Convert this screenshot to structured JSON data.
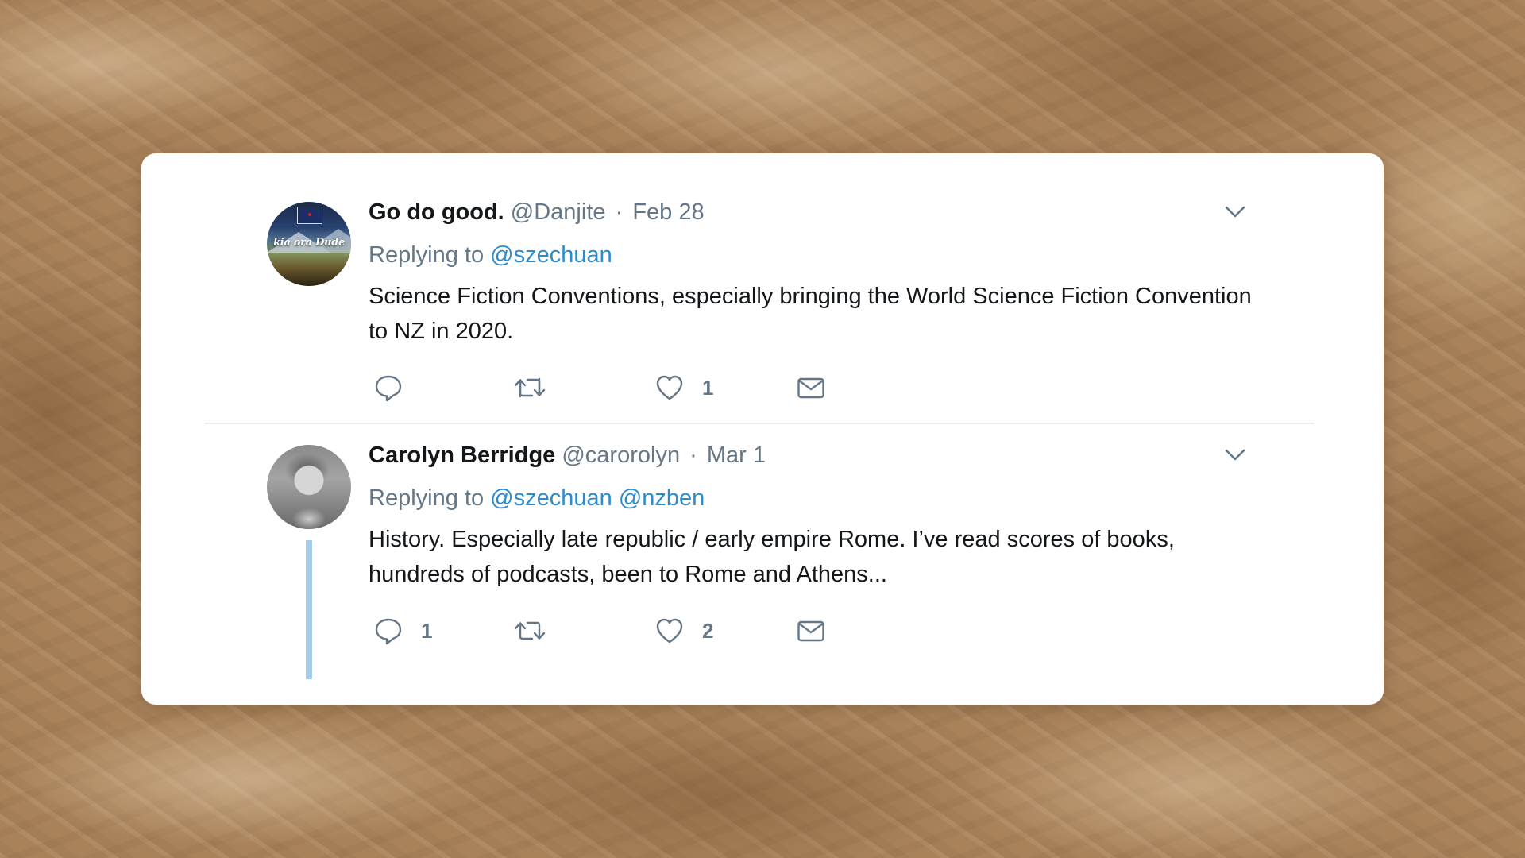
{
  "colors": {
    "card_background": "#ffffff",
    "name_text": "#14171a",
    "secondary_text": "#657786",
    "mention_link": "#2a8ccf",
    "thread_line": "#a3cde6",
    "background_marble": "#a9825a"
  },
  "tweets": [
    {
      "display_name": "Go do good.",
      "handle": "@Danjite",
      "separator": "·",
      "date": "Feb 28",
      "replying_to_label": "Replying to",
      "mentions": [
        "@szechuan"
      ],
      "text": "Science Fiction Conventions, especially bringing the World Science Fiction Convention to NZ in 2020.",
      "avatar_text": "kia ora Dude",
      "actions": {
        "reply_count": "",
        "retweet_count": "",
        "like_count": "1"
      },
      "icons": [
        "reply-icon",
        "retweet-icon",
        "like-icon",
        "direct-message-icon",
        "chevron-down-icon"
      ]
    },
    {
      "display_name": "Carolyn Berridge",
      "handle": "@carorolyn",
      "separator": "·",
      "date": "Mar 1",
      "replying_to_label": "Replying to",
      "mentions": [
        "@szechuan",
        "@nzben"
      ],
      "text": "History. Especially late republic / early empire Rome. I’ve read scores of books, hundreds of podcasts, been to Rome and Athens...",
      "actions": {
        "reply_count": "1",
        "retweet_count": "",
        "like_count": "2"
      },
      "icons": [
        "reply-icon",
        "retweet-icon",
        "like-icon",
        "direct-message-icon",
        "chevron-down-icon"
      ]
    }
  ]
}
